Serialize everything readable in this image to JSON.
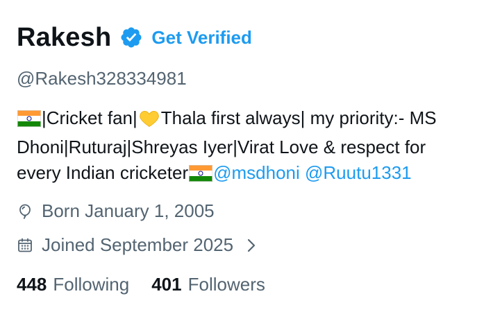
{
  "profile": {
    "name": "Rakesh",
    "get_verified_label": "Get Verified",
    "handle": "@Rakesh328334981",
    "bio": {
      "line1_a": "|Cricket fan|",
      "line1_b": "Thala first always| my priority:- MS",
      "line2": "Dhoni|Ruturaj|Shreyas Iyer|Virat Love & respect for",
      "line3": "every Indian cricketer",
      "mention1": "@msdhoni",
      "mention2": "@Ruutu1331"
    },
    "born": "Born January 1, 2005",
    "joined": "Joined September 2025",
    "following_count": "448",
    "following_label": "Following",
    "followers_count": "401",
    "followers_label": "Followers"
  },
  "icons": {
    "verified": "verified-badge-icon",
    "birthday": "balloon-icon",
    "joined": "calendar-icon",
    "chevron": "chevron-right-icon",
    "flag": "india-flag-emoji",
    "heart": "yellow-heart-emoji"
  },
  "colors": {
    "accent": "#1d9bf0",
    "text_primary": "#0f1419",
    "text_secondary": "#536471",
    "heart": "#ffcc33"
  }
}
